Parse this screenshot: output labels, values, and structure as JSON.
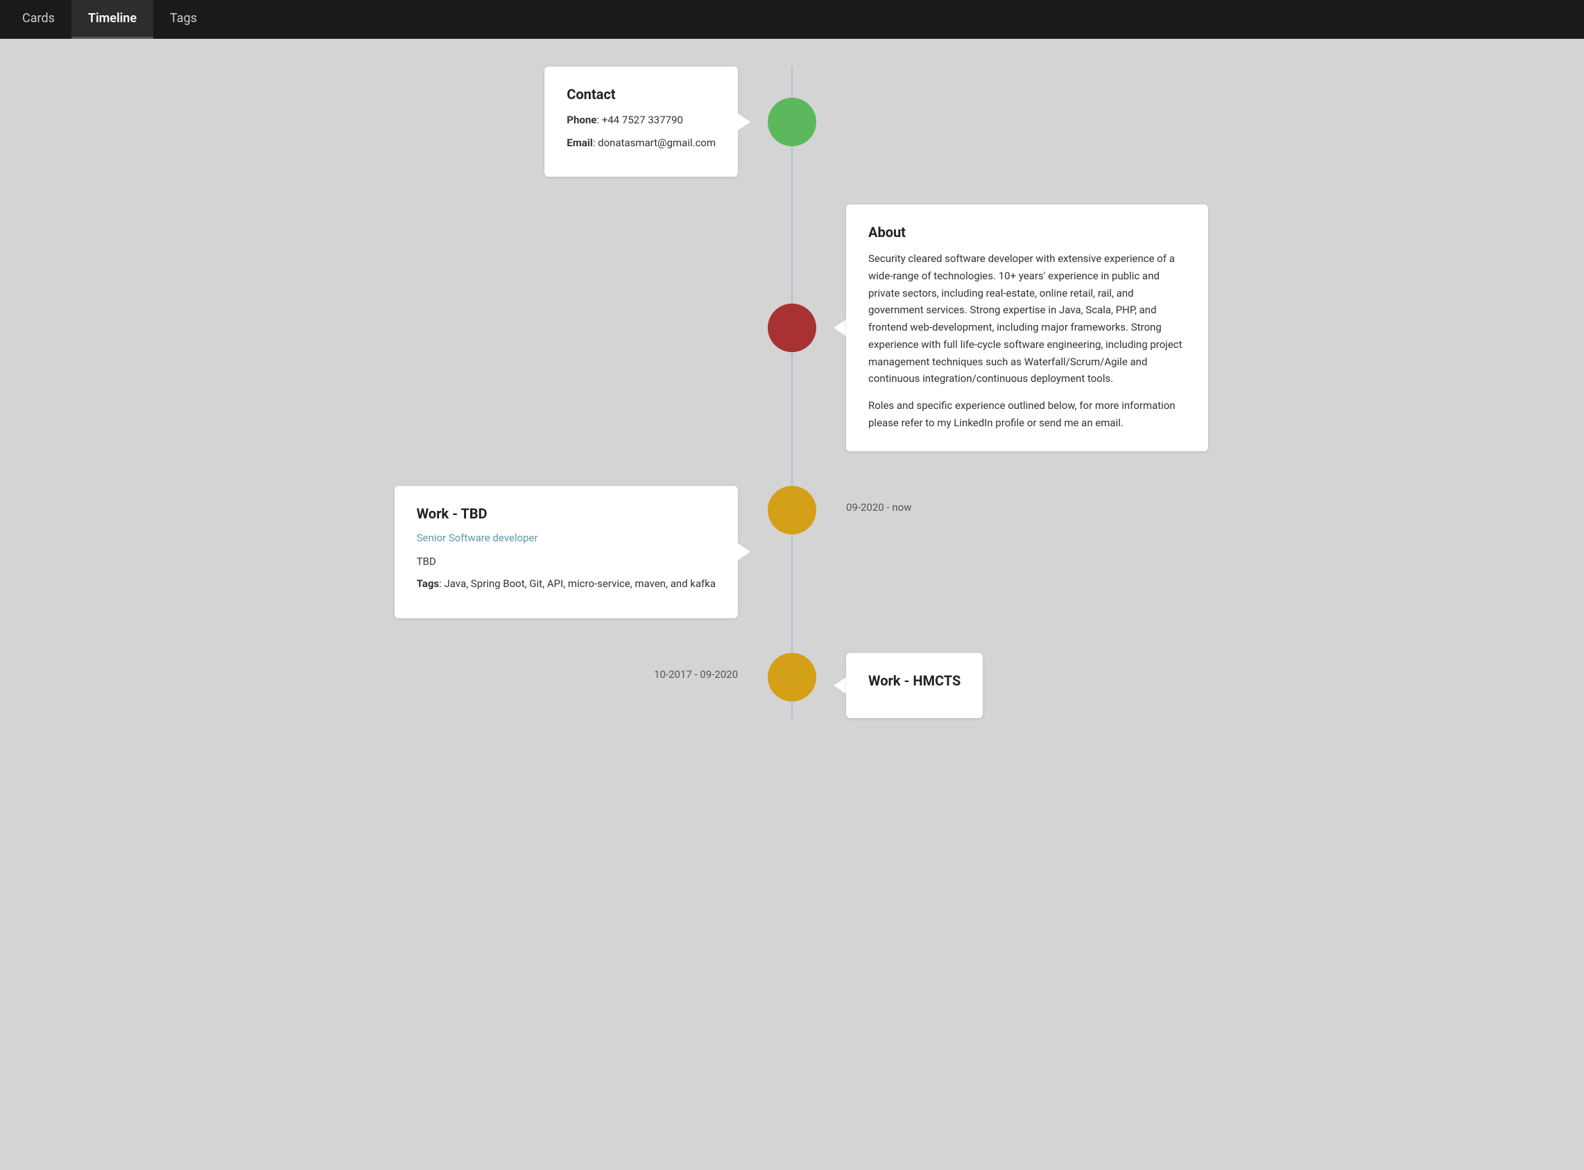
{
  "nav": {
    "items": [
      {
        "id": "cards",
        "label": "Cards",
        "active": false
      },
      {
        "id": "timeline",
        "label": "Timeline",
        "active": true
      },
      {
        "id": "tags",
        "label": "Tags",
        "active": false
      }
    ]
  },
  "timeline": {
    "rows": [
      {
        "id": "contact",
        "side": "left",
        "dot_color": "green",
        "dot_class": "dot-green",
        "card": {
          "title": "Contact",
          "fields": [
            {
              "label": "Phone",
              "value": "+44 7527 337790"
            },
            {
              "label": "Email",
              "value": "donatasmart@gmail.com"
            }
          ]
        }
      },
      {
        "id": "about",
        "side": "right",
        "dot_color": "red",
        "dot_class": "dot-red",
        "card": {
          "title": "About",
          "body_paragraphs": [
            "Security cleared software developer with extensive experience of a wide-range of technologies. 10+ years' experience in public and private sectors, including real-estate, online retail, rail, and government services. Strong expertise in Java, Scala, PHP, and frontend web-development, including major frameworks. Strong experience with full life-cycle software engineering, including project management techniques such as Waterfall/Scrum/Agile and continuous integration/continuous deployment tools.",
            "Roles and specific experience outlined below, for more information please refer to my LinkedIn profile or send me an email."
          ]
        }
      },
      {
        "id": "work-tbd",
        "side": "left",
        "dot_color": "yellow",
        "dot_class": "dot-yellow",
        "date": "09-2020 - now",
        "card": {
          "title": "Work - TBD",
          "subtitle": "Senior Software developer",
          "body": "TBD",
          "tags": "Java, Spring Boot, Git, API, micro-service, maven, and kafka"
        }
      },
      {
        "id": "work-hmcts",
        "side": "right",
        "dot_color": "yellow",
        "dot_class": "dot-yellow",
        "date": "10-2017 - 09-2020",
        "card": {
          "title": "Work - HMCTS"
        }
      }
    ]
  }
}
